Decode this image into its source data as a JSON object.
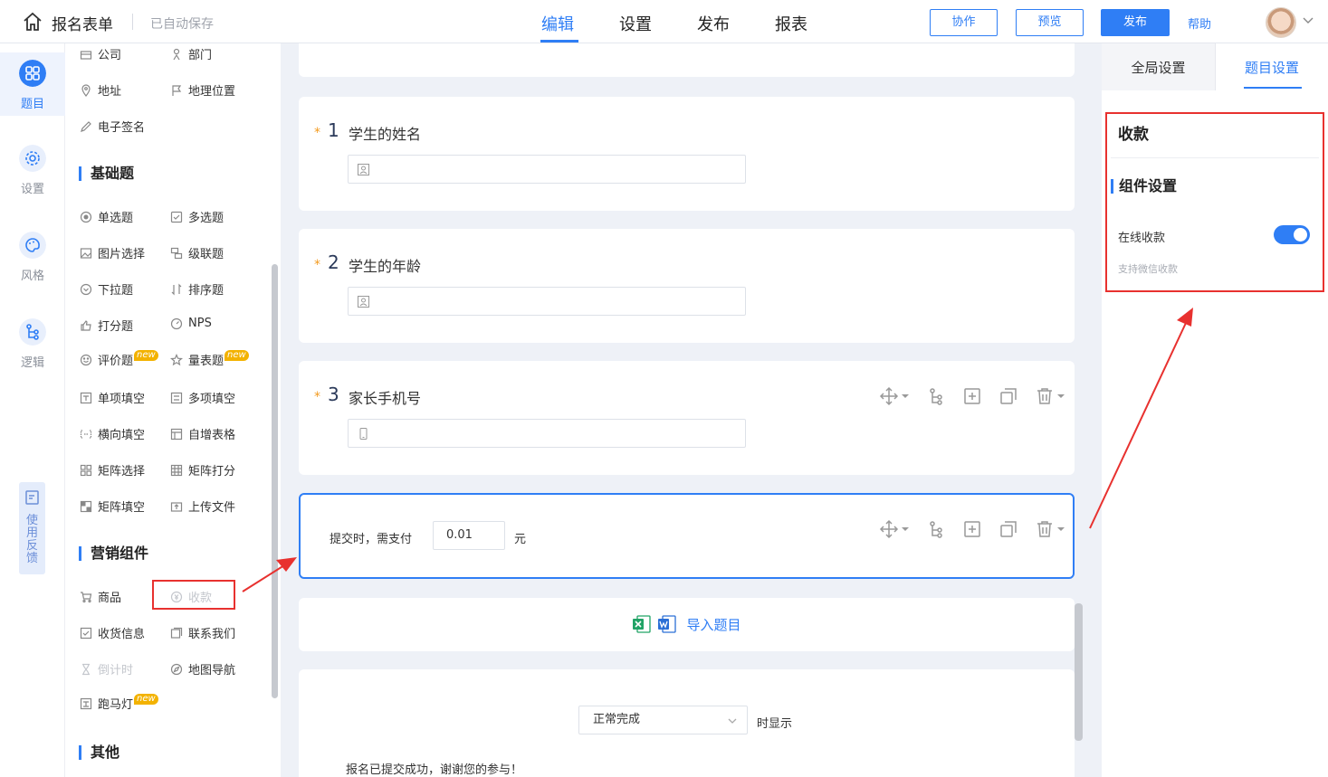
{
  "header": {
    "title": "报名表单",
    "autosave": "已自动保存",
    "tabs": [
      {
        "label": "编辑",
        "active": true
      },
      {
        "label": "设置",
        "active": false
      },
      {
        "label": "发布",
        "active": false
      },
      {
        "label": "报表",
        "active": false
      }
    ],
    "collaborate_label": "协作",
    "preview_label": "预览",
    "publish_label": "发布",
    "help_label": "帮助"
  },
  "rail": {
    "items": [
      {
        "label": "题目",
        "icon": "grid-icon",
        "active": true
      },
      {
        "label": "设置",
        "icon": "gear-icon",
        "active": false
      },
      {
        "label": "风格",
        "icon": "palette-icon",
        "active": false
      },
      {
        "label": "逻辑",
        "icon": "logic-branch-icon",
        "active": false
      }
    ],
    "feedback_label": "使用反馈"
  },
  "components": {
    "top_items": [
      {
        "label": "公司",
        "icon": "building-icon"
      },
      {
        "label": "部门",
        "icon": "person-icon"
      },
      {
        "label": "地址",
        "icon": "location-pin-icon"
      },
      {
        "label": "地理位置",
        "icon": "flag-icon"
      },
      {
        "label": "电子签名",
        "icon": "pen-icon"
      }
    ],
    "basic_title": "基础题",
    "basic_items": [
      {
        "label": "单选题",
        "icon": "radio-icon"
      },
      {
        "label": "多选题",
        "icon": "checkbox-icon"
      },
      {
        "label": "图片选择",
        "icon": "image-icon"
      },
      {
        "label": "级联题",
        "icon": "cascade-icon"
      },
      {
        "label": "下拉题",
        "icon": "dropdown-icon"
      },
      {
        "label": "排序题",
        "icon": "sort-icon"
      },
      {
        "label": "打分题",
        "icon": "thumb-up-icon"
      },
      {
        "label": "NPS",
        "icon": "gauge-icon"
      },
      {
        "label": "评价题",
        "icon": "smile-icon",
        "badge": "new"
      },
      {
        "label": "量表题",
        "icon": "star-icon",
        "badge": "new"
      },
      {
        "label": "单项填空",
        "icon": "single-fill-icon"
      },
      {
        "label": "多项填空",
        "icon": "multi-fill-icon"
      },
      {
        "label": "横向填空",
        "icon": "inline-fill-icon"
      },
      {
        "label": "自增表格",
        "icon": "table-icon"
      },
      {
        "label": "矩阵选择",
        "icon": "matrix-select-icon"
      },
      {
        "label": "矩阵打分",
        "icon": "matrix-score-icon"
      },
      {
        "label": "矩阵填空",
        "icon": "matrix-fill-icon"
      },
      {
        "label": "上传文件",
        "icon": "upload-icon"
      }
    ],
    "marketing_title": "营销组件",
    "marketing_items": [
      {
        "label": "商品",
        "icon": "cart-icon"
      },
      {
        "label": "收款",
        "icon": "payment-icon",
        "disabled": true
      },
      {
        "label": "收货信息",
        "icon": "shipping-icon"
      },
      {
        "label": "联系我们",
        "icon": "contact-icon"
      },
      {
        "label": "倒计时",
        "icon": "hourglass-icon",
        "disabled": true
      },
      {
        "label": "地图导航",
        "icon": "compass-icon"
      },
      {
        "label": "跑马灯",
        "icon": "marquee-icon",
        "badge": "new"
      }
    ],
    "other_title": "其他"
  },
  "questions": [
    {
      "number": "1",
      "title": "学生的姓名",
      "required": "*",
      "input_icon": "id-card-icon"
    },
    {
      "number": "2",
      "title": "学生的年龄",
      "required": "*",
      "input_icon": "id-card-icon"
    },
    {
      "number": "3",
      "title": "家长手机号",
      "required": "*",
      "input_icon": "phone-icon"
    }
  ],
  "payment": {
    "label": "提交时，需支付",
    "amount": "0.01",
    "unit": "元"
  },
  "import": {
    "label": "导入题目"
  },
  "completion": {
    "select_value": "正常完成",
    "suffix": "时显示",
    "message": "报名已提交成功，谢谢您的参与！"
  },
  "right_panel": {
    "tabs": [
      {
        "label": "全局设置",
        "active": false
      },
      {
        "label": "题目设置",
        "active": true
      }
    ],
    "title": "收款",
    "section_title": "组件设置",
    "online_payment_label": "在线收款",
    "online_payment_enabled": true,
    "hint": "支持微信收款"
  },
  "colors": {
    "accent": "#2f7ef5",
    "annotation_red": "#e8312f",
    "required_star": "#f39a1e",
    "badge": "#f3b200"
  }
}
